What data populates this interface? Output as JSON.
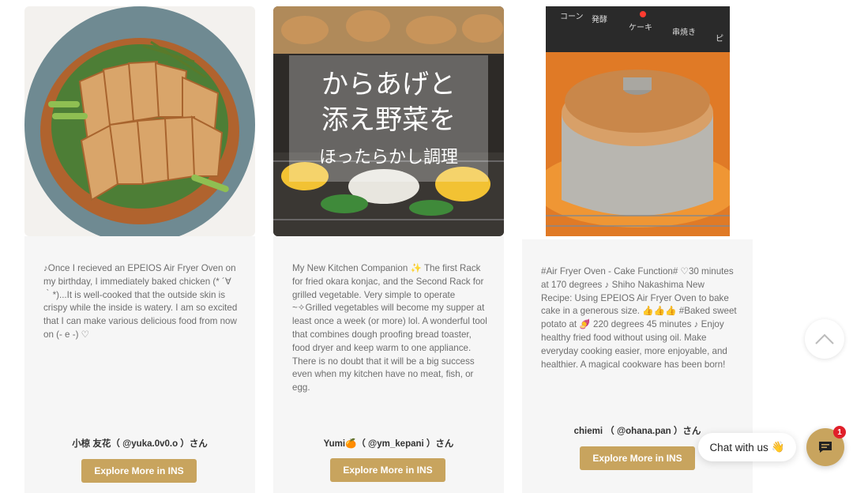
{
  "cards": [
    {
      "image_alt": "Grilled chicken with asparagus on a plate",
      "review": "♪Once I recieved an EPEIOS Air Fryer Oven on my birthday, I immediately baked chicken (* ´∀｀*)...It is well-cooked that the outside skin is crispy while the inside is watery. I am so excited that I can make various delicious food from now on (- e -) ♡",
      "author": "小椋 友花（ @yuka.0v0.o ）さん",
      "button": "Explore More in INS"
    },
    {
      "image_alt": "Oven tray with roasted vegetables and karaage",
      "overlay_lines": [
        "からあげと",
        "添え野菜を",
        "ほったらかし調理"
      ],
      "review": "My New Kitchen Companion ✨ The first Rack for fried okara konjac, and the Second Rack for grilled vegetable. Very simple to operate ~✧Grilled vegetables will become my supper at least once a week (or more) lol. A wonderful tool that combines dough proofing bread toaster, food dryer and keep warm to one appliance. There is no doubt that it will be a big success even when my kitchen have no meat, fish, or egg.",
      "author": "Yumi🍊（ @ym_kepani ）さん",
      "button": "Explore More in INS"
    },
    {
      "image_alt": "Chiffon cake baking in the air fryer oven",
      "oven_labels": [
        "コーン",
        "発酵",
        "ケーキ",
        "串焼き",
        "ピ"
      ],
      "review": "#Air Fryer Oven - Cake Function# ♡30 minutes at 170 degrees ♪ Shiho Nakashima New Recipe: Using EPEIOS Air Fryer Oven to bake cake in a generous size. 👍👍👍 #Baked sweet potato at 🍠 220 degrees 45 minutes ♪ Enjoy healthy fried food without using oil. Make everyday cooking easier, more enjoyable, and healthier. A magical cookware has been born!",
      "author": "chiemi （ @ohana.pan ）さん",
      "button": "Explore More in INS"
    }
  ],
  "chat": {
    "label": "Chat with us",
    "emoji": "👋",
    "badge": "1"
  },
  "icons": {
    "scroll_top": "chevron-up-icon",
    "chat": "chat-bubble-icon"
  },
  "colors": {
    "accent": "#c8a45e",
    "card_bg": "#f6f6f6",
    "badge": "#e0202a"
  }
}
